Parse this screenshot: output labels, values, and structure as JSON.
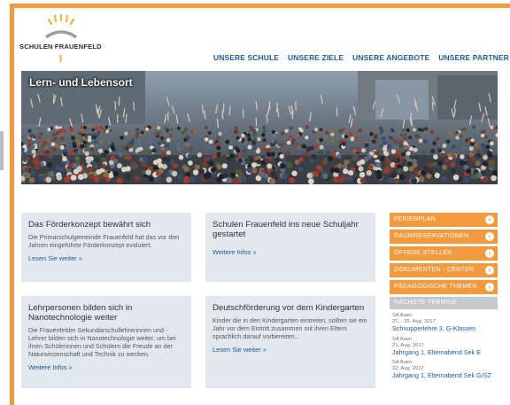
{
  "logo": {
    "text": "SCHULEN FRAUENFELD"
  },
  "nav": [
    {
      "label": "UNSERE SCHULE"
    },
    {
      "label": "UNSERE ZIELE"
    },
    {
      "label": "UNSERE ANGEBOTE"
    },
    {
      "label": "UNSERE PARTNER"
    }
  ],
  "hero": {
    "caption": "Lern- und Lebensort"
  },
  "cards": [
    {
      "title": "Das Förderkonzept bewährt sich",
      "text": "Die Primarschulgemeinde Frauenfeld hat das vor drei Jahren eingeführte Förderkonzept evaluiert.",
      "link": "Lesen Sie weiter »"
    },
    {
      "title": "Schulen Frauenfeld ins neue Schuljahr gestartet",
      "text": "",
      "link": "Weitere Infos »"
    },
    {
      "title": "Lehrpersonen bilden sich in Nanotechnologie weiter",
      "text": "Die Frauenfelder Sekundarschullehrerinnen und -Lehrer bilden sich in Nanotechnologie weiter, um bei ihren Schülerinnen und Schülern die Freude an der Naturwissenschaft und Technik zu wecken.",
      "link": "Weitere Infos »"
    },
    {
      "title": "Deutschförderung vor dem Kindergarten",
      "text": "Kinder die in den Kindergarten eintreten, sollten sie ein Jahr vor dem Eintritt zusammen mit ihren Eltern sprachlich darauf vorbereiten...",
      "link": "Lesen Sie weiter »"
    }
  ],
  "sidebar": {
    "buttons": [
      {
        "label": "FERIENPLAN"
      },
      {
        "label": "RAUMRESERVATIONEN"
      },
      {
        "label": "OFFENE STELLEN"
      },
      {
        "label": "DOKUMENTEN - CENTER"
      },
      {
        "label": "PÄDAGOGISCHE THEMEN"
      }
    ],
    "events_title": "NÄCHSTE TERMINE",
    "events": [
      {
        "location": "SA Auen",
        "date": "21. - 25. Aug. 2017",
        "title": "Schnupperlehre 3. G-Klassen"
      },
      {
        "location": "SA Auen",
        "date": "21. Aug. 2017",
        "title": "Jahrgang 1, Elternabend Sek E"
      },
      {
        "location": "SA Auen",
        "date": "22. Aug. 2017",
        "title": "Jahrgang 1, Elternabend Sek G/SZ"
      }
    ]
  },
  "colors": {
    "accent": "#f39a3c",
    "link": "#1e5a9e",
    "card": "#e1e8ee"
  }
}
